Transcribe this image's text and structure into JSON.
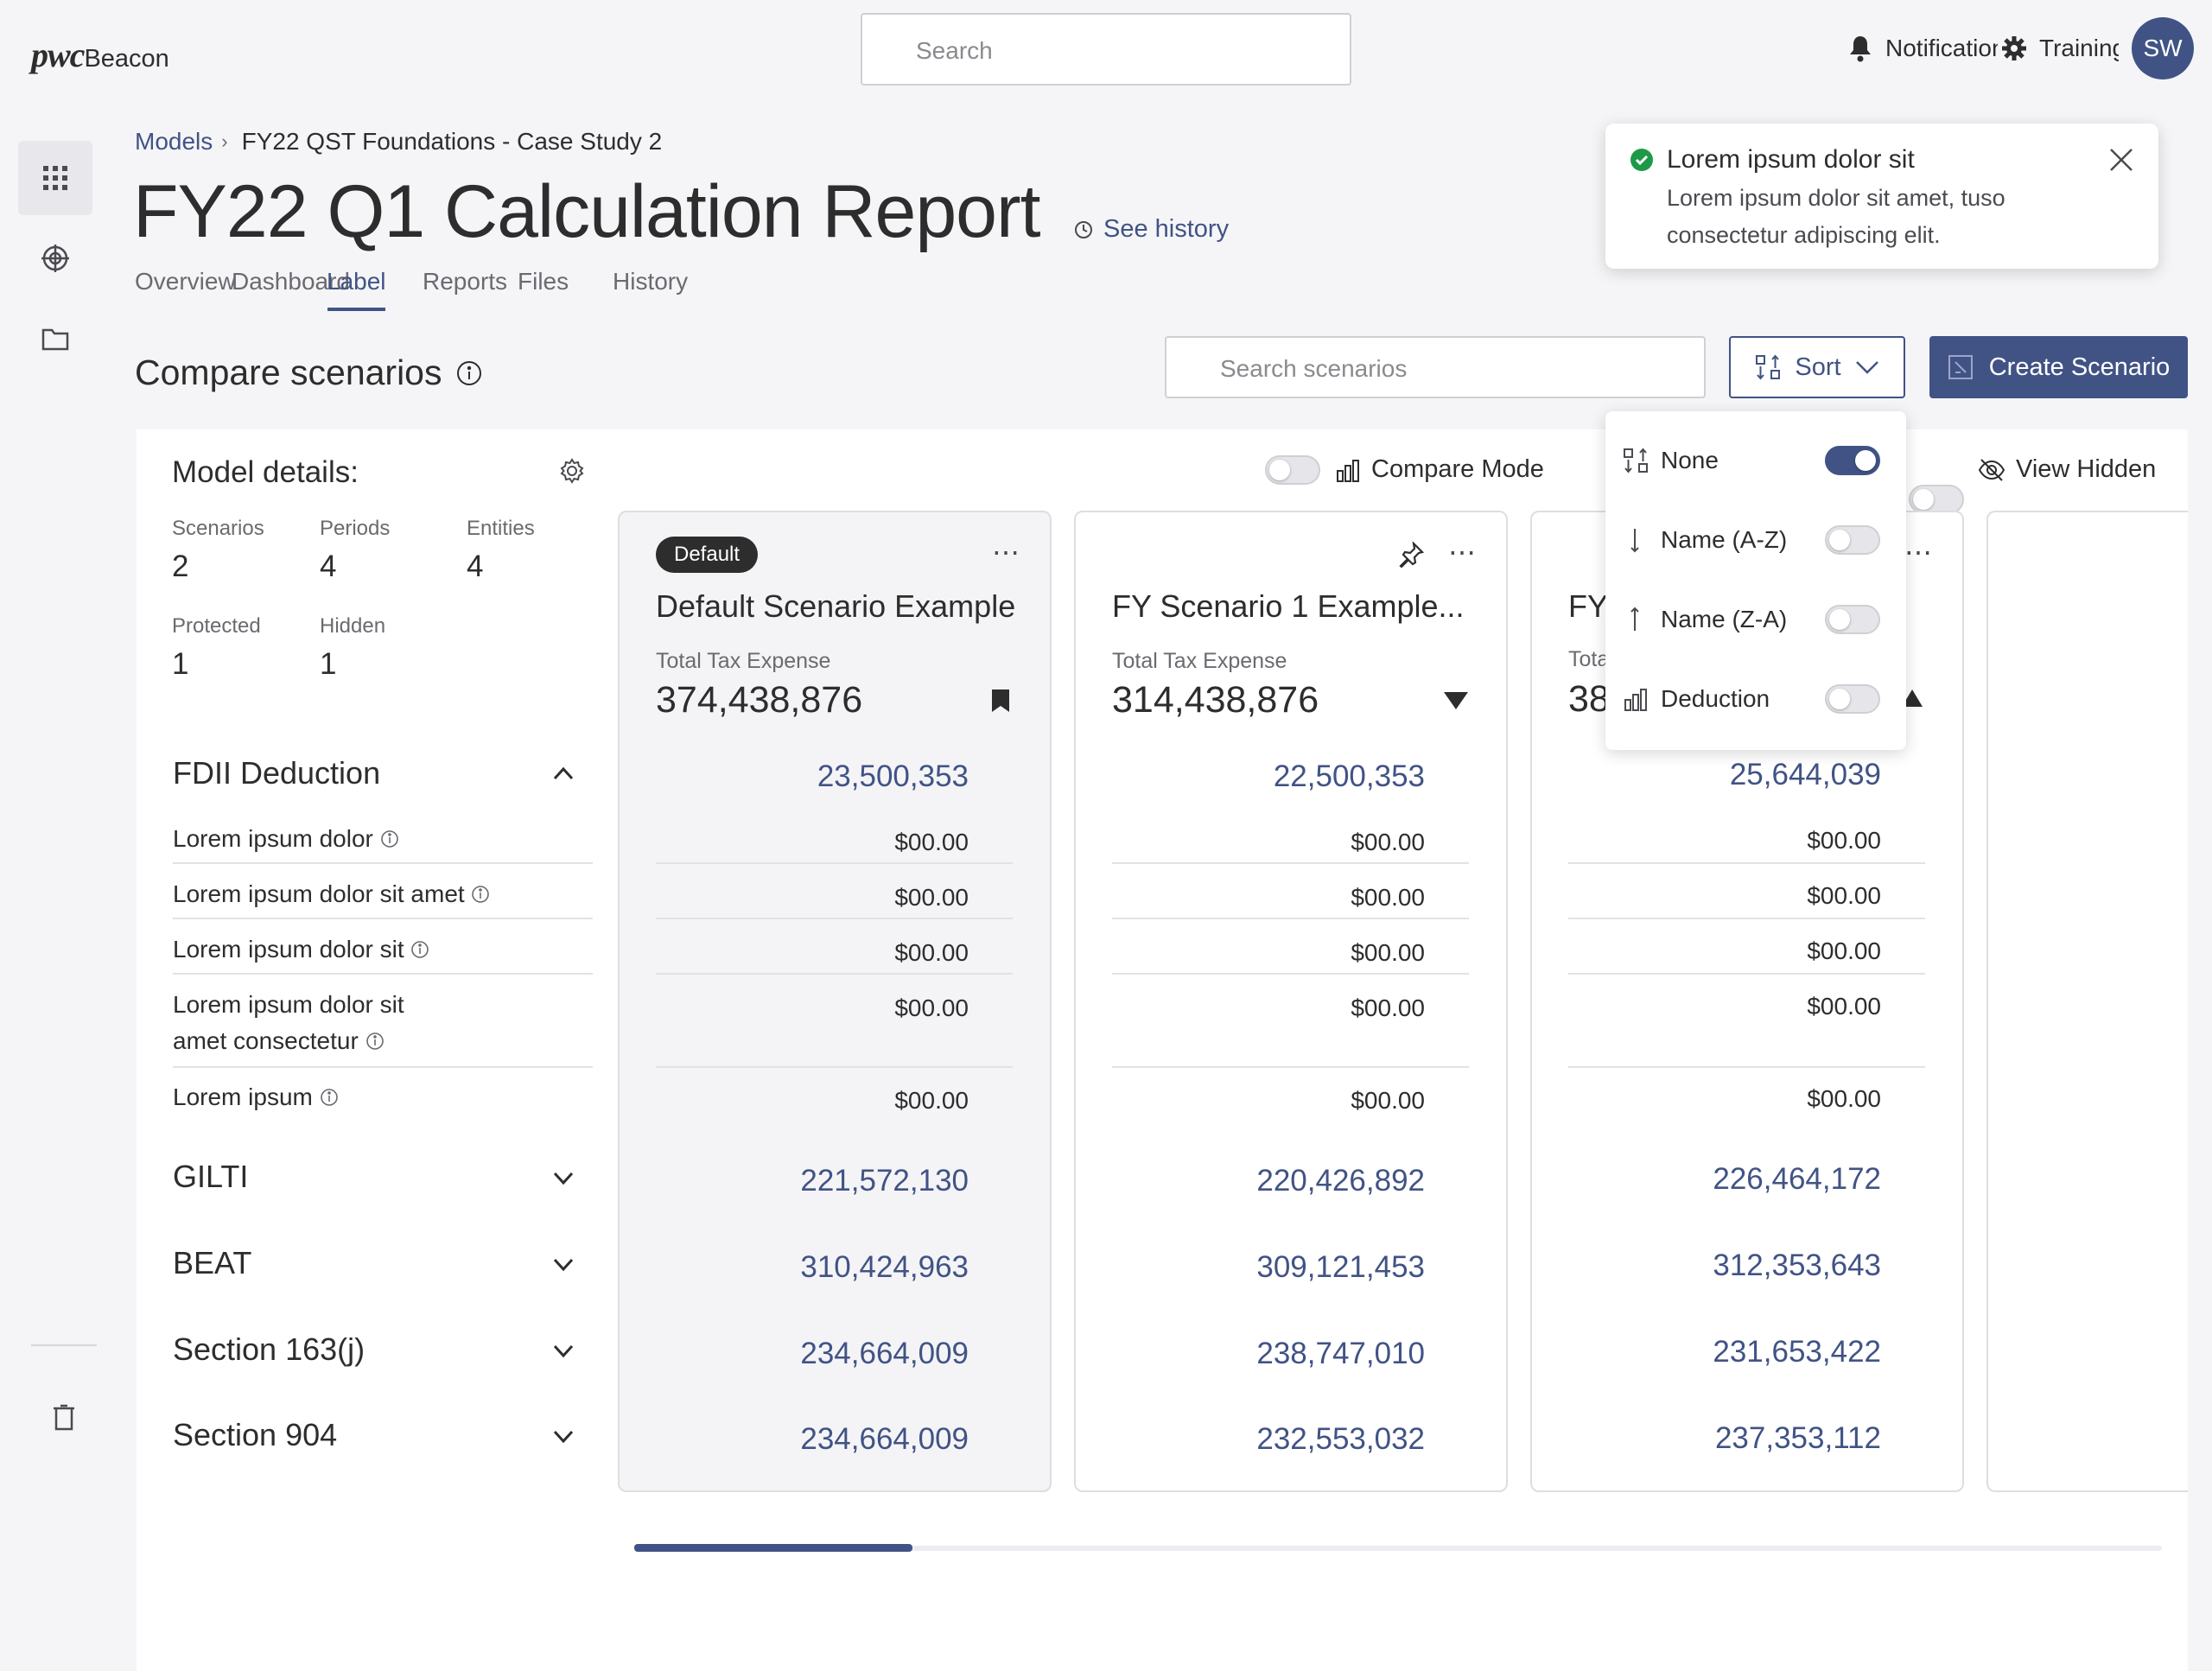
{
  "header": {
    "logo_pwc": "pwc",
    "logo_app": "Beacon",
    "search_placeholder": "Search",
    "notifications": "Notifications",
    "training": "Training",
    "avatar_initials": "SW"
  },
  "breadcrumb": {
    "models": "Models",
    "current": "FY22 QST Foundations - Case Study 2"
  },
  "page": {
    "title": "FY22 Q1 Calculation Report",
    "see_history": "See history"
  },
  "tabs": [
    "Overview",
    "Dashboard",
    "Label",
    "Reports",
    "Files",
    "History"
  ],
  "compare": {
    "title": "Compare scenarios",
    "search_placeholder": "Search scenarios",
    "sort_label": "Sort",
    "create_label": "Create Scenario",
    "compare_mode": "Compare Mode",
    "view_hidden": "View Hidden"
  },
  "model_details": {
    "title": "Model details:",
    "stats": [
      {
        "label": "Scenarios",
        "value": "2"
      },
      {
        "label": "Periods",
        "value": "4"
      },
      {
        "label": "Entities",
        "value": "4"
      },
      {
        "label": "Protected",
        "value": "1"
      },
      {
        "label": "Hidden",
        "value": "1"
      }
    ]
  },
  "sections": {
    "fdii": {
      "title": "FDII Deduction",
      "rows": [
        "Lorem ipsum dolor",
        "Lorem ipsum dolor sit amet",
        "Lorem ipsum dolor sit",
        "Lorem ipsum dolor sit",
        "amet consectetur",
        "Lorem ipsum"
      ]
    },
    "collapsed": [
      "GILTI",
      "BEAT",
      "Section 163(j)",
      "Section 904"
    ]
  },
  "cards": [
    {
      "badge": "Default",
      "title": "Default Scenario Example",
      "sub": "Total Tax Expense",
      "total": "374,438,876",
      "fdii": "23,500,353",
      "rows": [
        "$00.00",
        "$00.00",
        "$00.00",
        "$00.00",
        "$00.00"
      ],
      "sections": [
        "221,572,130",
        "310,424,963",
        "234,664,009",
        "234,664,009"
      ]
    },
    {
      "title": "FY Scenario 1 Example...",
      "sub": "Total Tax Expense",
      "total": "314,438,876",
      "fdii": "22,500,353",
      "rows": [
        "$00.00",
        "$00.00",
        "$00.00",
        "$00.00",
        "$00.00"
      ],
      "sections": [
        "220,426,892",
        "309,121,453",
        "238,747,010",
        "232,553,032"
      ]
    },
    {
      "title_partial": "FY",
      "sub_partial": "Tota",
      "total_partial": "38",
      "fdii": "25,644,039",
      "rows": [
        "$00.00",
        "$00.00",
        "$00.00",
        "$00.00",
        "$00.00"
      ],
      "sections": [
        "226,464,172",
        "312,353,643",
        "231,653,422",
        "237,353,112"
      ]
    }
  ],
  "sort_menu": {
    "items": [
      {
        "label": "None",
        "on": true
      },
      {
        "label": "Name (A-Z)",
        "on": false
      },
      {
        "label": "Name (Z-A)",
        "on": false
      },
      {
        "label": "Deduction",
        "on": false
      }
    ]
  },
  "toast": {
    "title": "Lorem ipsum dolor sit",
    "body": "Lorem ipsum dolor sit amet, tuso consectetur adipiscing elit."
  },
  "colors": {
    "primary": "#415385",
    "success": "#1d9a48"
  }
}
